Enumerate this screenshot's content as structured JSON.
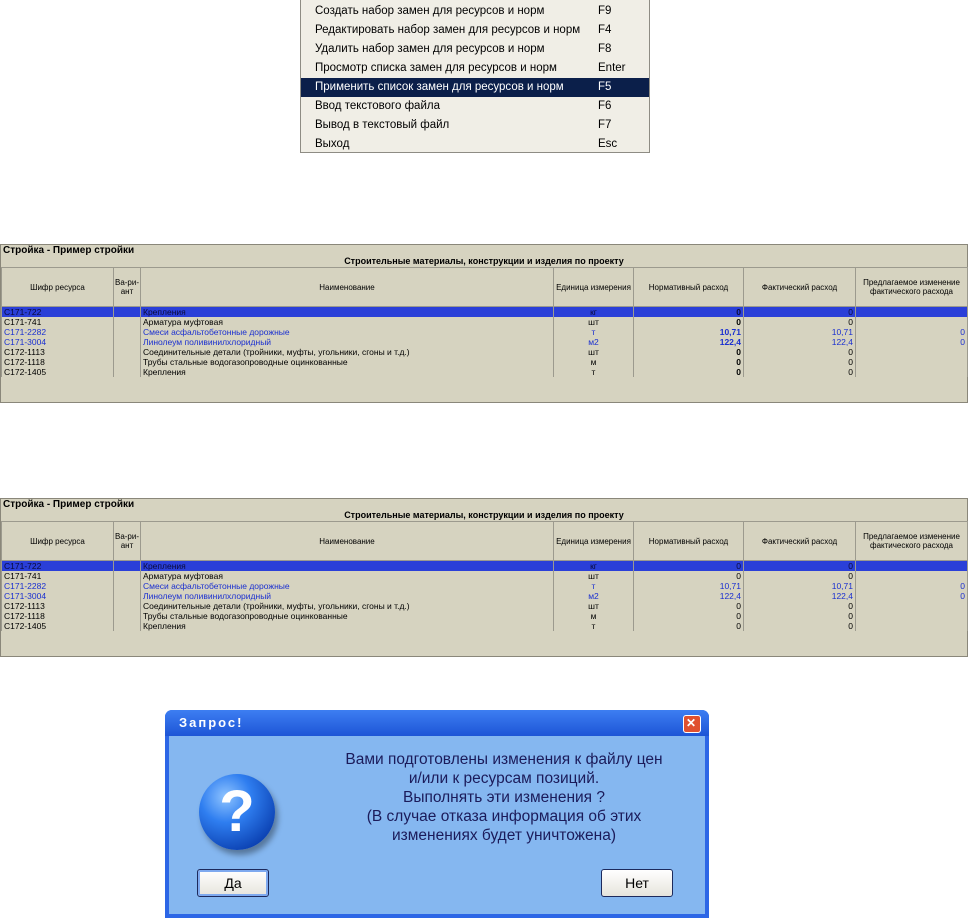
{
  "menu": {
    "items": [
      {
        "label": "Создать набор замен для ресурсов и норм",
        "shortcut": "F9"
      },
      {
        "label": "Редактировать набор замен для ресурсов и норм",
        "shortcut": "F4"
      },
      {
        "label": "Удалить набор замен для ресурсов и норм",
        "shortcut": "F8"
      },
      {
        "label": "Просмотр списка замен для ресурсов и норм",
        "shortcut": "Enter"
      },
      {
        "label": "Применить список замен для ресурсов и норм",
        "shortcut": "F5"
      },
      {
        "label": "Ввод текстового файла",
        "shortcut": "F6"
      },
      {
        "label": "Вывод в текстовый файл",
        "shortcut": "F7"
      },
      {
        "label": "Выход",
        "shortcut": "Esc"
      }
    ],
    "selected_index": 4
  },
  "table1": {
    "title": "Стройка - Пример стройки",
    "subtitle": "Строительные материалы, конструкции и изделия по проекту",
    "headers": {
      "code": "Шифр ресурса",
      "variant": "Ва-ри-ант",
      "name": "Наименование",
      "unit": "Единица измерения",
      "norm": "Нормативный расход",
      "fact": "Фактический расход",
      "proposed": "Предлагаемое изменение фактического расхода"
    },
    "rows": [
      {
        "code": "С171-722",
        "variant": "",
        "name": "Крепления",
        "unit": "кг",
        "norm": "0",
        "fact": "0",
        "proposed": ""
      },
      {
        "code": "С171-741",
        "variant": "",
        "name": "Арматура муфтовая",
        "unit": "шт",
        "norm": "0",
        "fact": "0",
        "proposed": ""
      },
      {
        "code": "С171-2282",
        "variant": "",
        "name": "Смеси асфальтобетонные дорожные",
        "unit": "т",
        "norm": "10,71",
        "fact": "10,71",
        "proposed": "0"
      },
      {
        "code": "С171-3004",
        "variant": "",
        "name": "Линолеум поливинилхлоридный",
        "unit": "м2",
        "norm": "122,4",
        "fact": "122,4",
        "proposed": "0"
      },
      {
        "code": "С172-1113",
        "variant": "",
        "name": "Соединительные детали (тройники, муфты, угольники, сгоны и т.д.)",
        "unit": "шт",
        "norm": "0",
        "fact": "0",
        "proposed": ""
      },
      {
        "code": "С172-1118",
        "variant": "",
        "name": "Трубы стальные водогазопроводные оцинкованные",
        "unit": "м",
        "norm": "0",
        "fact": "0",
        "proposed": ""
      },
      {
        "code": "С172-1405",
        "variant": "",
        "name": "Крепления",
        "unit": "т",
        "norm": "0",
        "fact": "0",
        "proposed": ""
      }
    ]
  },
  "table2": {
    "title": "Стройка - Пример стройки",
    "subtitle": "Строительные материалы, конструкции и изделия по проекту",
    "headers": {
      "code": "Шифр ресурса",
      "variant": "Ва-ри-ант",
      "name": "Наименование",
      "unit": "Единица измерения",
      "norm": "Нормативный расход",
      "fact": "Фактический расход",
      "proposed": "Предлагаемое изменение фактического расхода"
    },
    "rows": [
      {
        "code": "С171-722",
        "variant": "",
        "name": "Крепления",
        "unit": "кг",
        "norm": "0",
        "fact": "0",
        "proposed": ""
      },
      {
        "code": "С171-741",
        "variant": "",
        "name": "Арматура муфтовая",
        "unit": "шт",
        "norm": "0",
        "fact": "0",
        "proposed": ""
      },
      {
        "code": "С171-2282",
        "variant": "",
        "name": "Смеси асфальтобетонные дорожные",
        "unit": "т",
        "norm": "10,71",
        "fact": "10,71",
        "proposed": "0"
      },
      {
        "code": "С171-3004",
        "variant": "",
        "name": "Линолеум поливинилхлоридный",
        "unit": "м2",
        "norm": "122,4",
        "fact": "122,4",
        "proposed": "0"
      },
      {
        "code": "С172-1113",
        "variant": "",
        "name": "Соединительные детали (тройники, муфты, угольники, сгоны и т.д.)",
        "unit": "шт",
        "norm": "0",
        "fact": "0",
        "proposed": ""
      },
      {
        "code": "С172-1118",
        "variant": "",
        "name": "Трубы стальные водогазопроводные оцинкованные",
        "unit": "м",
        "norm": "0",
        "fact": "0",
        "proposed": ""
      },
      {
        "code": "С172-1405",
        "variant": "",
        "name": "Крепления",
        "unit": "т",
        "norm": "0",
        "fact": "0",
        "proposed": ""
      }
    ]
  },
  "dialog": {
    "title": "Запрос!",
    "close_glyph": "✕",
    "icon": "question-icon",
    "icon_glyph": "?",
    "message_lines": [
      "Вами подготовлены изменения к файлу цен",
      "и/или к ресурсам позиций.",
      "Выполнять эти изменения ?",
      "(В случае отказа информация об этих",
      "изменениях будет уничтожена)"
    ],
    "yes_label": "Да",
    "no_label": "Нет"
  },
  "colors": {
    "selection_menu": "#0b1f4a",
    "selection_row": "#2a3fd8",
    "changed_row_text": "#1a2fd0",
    "panel_bg": "#d6d3c0",
    "dialog_frame": "#2c66e6",
    "dialog_body": "#85b7f0"
  }
}
